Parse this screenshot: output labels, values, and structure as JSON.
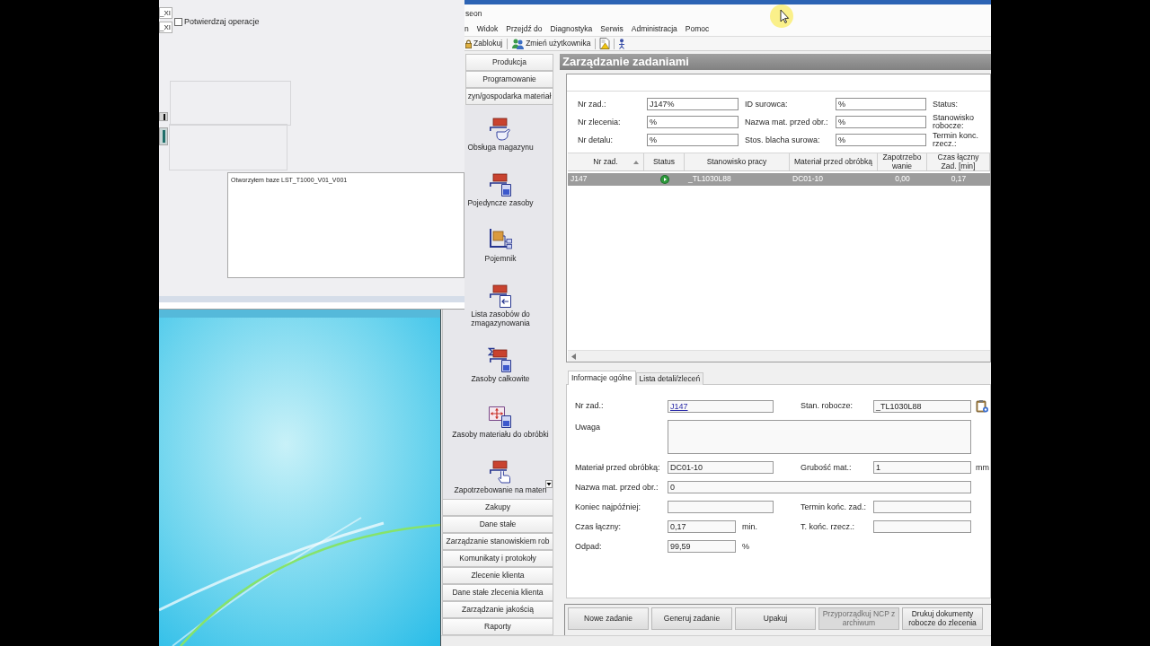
{
  "helper_window": {
    "fields": [
      "_XI",
      "_XI"
    ],
    "confirm": {
      "label": "Potwierdzaj operacje",
      "checked": false
    },
    "log": "Otworzyłem baze LST_T1000_V01_V001"
  },
  "window": {
    "title": "seon",
    "menu": [
      "n",
      "Widok",
      "Przejdź do",
      "Diagnostyka",
      "Serwis",
      "Administracja",
      "Pomoc"
    ],
    "toolbar": [
      {
        "kind": "lock",
        "label": "Zablokuj"
      },
      {
        "kind": "change-user",
        "label": "Zmień użytkownika"
      }
    ]
  },
  "nav": {
    "top_buttons": [
      "Produkcja",
      "Programowanie",
      "zyn/gospodarka materiał"
    ],
    "tools": [
      {
        "kind": "handling",
        "label": "Obsługa magazynu"
      },
      {
        "kind": "single",
        "label": "Pojedyncze zasoby"
      },
      {
        "kind": "container",
        "label": "Pojemnik"
      },
      {
        "kind": "storage",
        "label": "Lista zasobów do zmagazynowania"
      },
      {
        "kind": "total",
        "label": "Zasoby całkowite"
      },
      {
        "kind": "material",
        "label": "Zasoby materiału do obróbki"
      },
      {
        "kind": "demand",
        "label": "Zapotrzebowanie na materi"
      }
    ],
    "bottom_buttons": [
      "Zakupy",
      "Dane stałe",
      "Zarządzanie stanowiskiem rob",
      "Komunikaty i protokoły",
      "Zlecenie klienta",
      "Dane stałe zlecenia klienta",
      "Zarządzanie jakością",
      "Raporty"
    ]
  },
  "task_manager": {
    "title": "Zarządzanie zadaniami",
    "filters": [
      {
        "left": {
          "label": "Nr zad.:",
          "value": "J147%"
        },
        "middle": {
          "label": "ID surowca:",
          "value": "%"
        },
        "right_label": "Status:"
      },
      {
        "left": {
          "label": "Nr zlecenia:",
          "value": "%"
        },
        "middle": {
          "label": "Nazwa mat. przed obr.:",
          "value": "%"
        },
        "right_label": "Stanowisko robocze:"
      },
      {
        "left": {
          "label": "Nr detalu:",
          "value": "%"
        },
        "middle": {
          "label": "Stos. blacha surowa:",
          "value": "%"
        },
        "right_label": "Termin konc. rzecz.:"
      }
    ],
    "table": {
      "columns": [
        {
          "label": "Nr zad.",
          "sorted": true
        },
        {
          "label": "Status",
          "sorted": false
        },
        {
          "label": "Stanowisko pracy",
          "sorted": false
        },
        {
          "label": "Materiał przed obróbką",
          "sorted": false
        },
        {
          "label": "Zapotrzebowanie",
          "sorted": false
        },
        {
          "label": "Czas łączny Zad. [min]",
          "sorted": false
        }
      ],
      "rows": [
        {
          "selected": true,
          "task_no": "J147",
          "running": true,
          "workstation": "_TL1030L88",
          "material": "DC01-10",
          "demand": "0,00",
          "total_time": "0,17"
        }
      ]
    },
    "tabs": [
      {
        "label": "Informacje ogólne",
        "selected": true
      },
      {
        "label": "Lista detali/zleceń",
        "selected": false
      }
    ],
    "form": [
      {
        "kind": "pair",
        "left": {
          "label": "Nr zad.:",
          "value": "J147",
          "link": true
        },
        "right": {
          "label": "Stan. robocze:",
          "value": "_TL1030L88",
          "picker": true
        }
      },
      {
        "kind": "memo",
        "label": "Uwaga"
      },
      {
        "kind": "pair",
        "left": {
          "label": "Materiał przed obróbką:",
          "value": "DC01-10"
        },
        "right": {
          "label": "Grubość mat.:",
          "value": "1",
          "unit": "mm"
        }
      },
      {
        "kind": "wide",
        "label": "Nazwa mat. przed obr.:",
        "value": "0"
      },
      {
        "kind": "pair",
        "left": {
          "label": "Koniec najpóźniej:"
        },
        "right": {
          "label": "Termin końc. zad.:"
        }
      },
      {
        "kind": "pair",
        "left": {
          "label": "Czas łączny:",
          "value": "0,17",
          "unit": "min."
        },
        "right": {
          "label": "T. końc. rzecz.:"
        }
      },
      {
        "kind": "single",
        "label": "Odpad:",
        "value": "99,59",
        "unit": "%"
      }
    ],
    "buttons": [
      {
        "label": "Nowe zadanie",
        "disabled": false
      },
      {
        "label": "Generuj zadanie",
        "disabled": false
      },
      {
        "label": "Upakuj",
        "disabled": false
      },
      {
        "label": "Przyporządkuj NCP z archiwum",
        "disabled": true
      },
      {
        "label": "Drukuj dokumenty robocze do zlecenia",
        "disabled": false
      }
    ]
  }
}
